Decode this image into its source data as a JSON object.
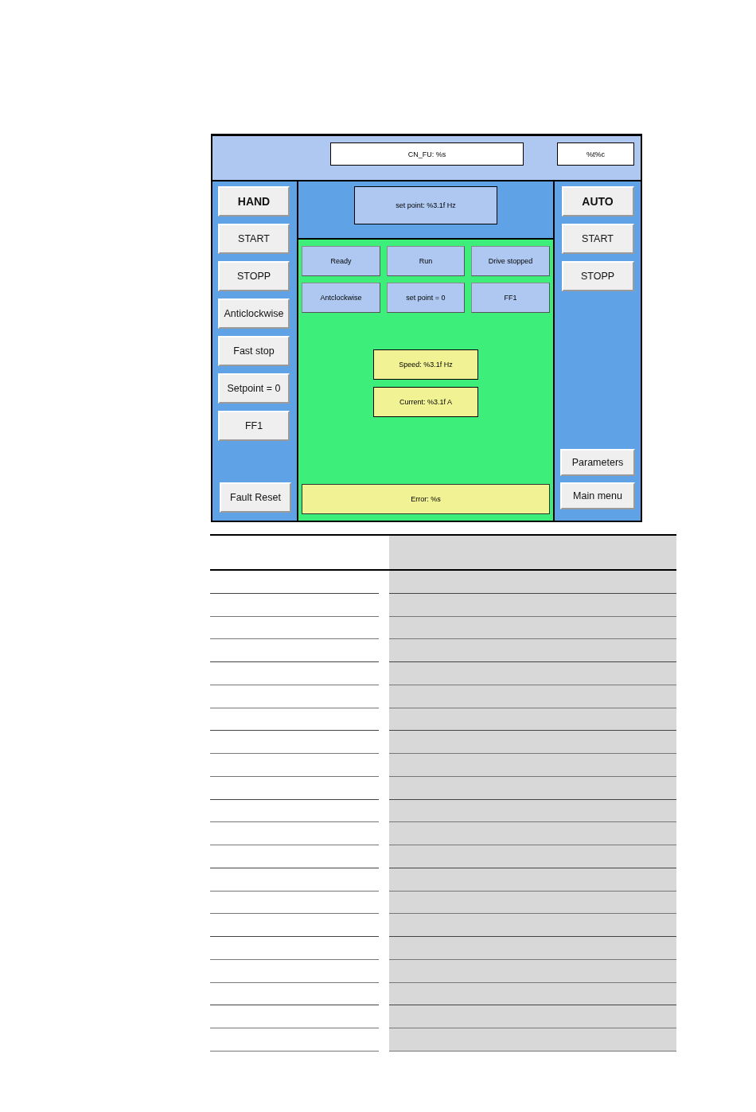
{
  "top_bar": {
    "displays": [
      {
        "kind": "wide",
        "text": "CN_FU: %s"
      },
      {
        "kind": "narrow",
        "text": "%t%c"
      }
    ]
  },
  "left_panel": {
    "buttons": [
      {
        "label": "HAND",
        "kind": "mode"
      },
      {
        "label": "START",
        "kind": "command"
      },
      {
        "label": "STOPP",
        "kind": "command"
      },
      {
        "label": "Anticlockwise",
        "kind": "command"
      },
      {
        "label": "Fast stop",
        "kind": "command"
      },
      {
        "label": "Setpoint = 0",
        "kind": "command"
      },
      {
        "label": "FF1",
        "kind": "command"
      }
    ],
    "footer_buttons": [
      {
        "label": "Fault Reset"
      }
    ]
  },
  "center_panel": {
    "setpoint_display": "set point: %3.1f Hz",
    "status_indicators": [
      "Ready",
      "Run",
      "Drive stopped",
      "Antclockwise",
      "set point = 0",
      "FF1"
    ],
    "readouts": [
      "Speed: %3.1f Hz",
      "Current: %3.1f A"
    ],
    "error_display": "Error: %s"
  },
  "right_panel": {
    "buttons": [
      {
        "label": "AUTO",
        "kind": "mode"
      },
      {
        "label": "START",
        "kind": "command"
      },
      {
        "label": "STOPP",
        "kind": "command"
      }
    ],
    "footer_buttons": [
      {
        "label": "Parameters"
      },
      {
        "label": "Main menu"
      }
    ]
  }
}
